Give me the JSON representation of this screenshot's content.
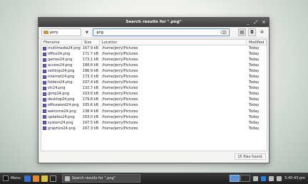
{
  "window": {
    "title": "Search results for \".png\"",
    "controls": {
      "minimize": "_",
      "maximize": "⤢",
      "close": "✕"
    }
  },
  "toolbar": {
    "location": "jerry",
    "dropdown_arrow": "▼",
    "search_value": ".png",
    "clear_icon": "⌫",
    "view_list_icon": "▤",
    "camera_icon": "◘",
    "settings_icon": "✲"
  },
  "columns": [
    "Filename",
    "Size",
    "Location",
    "Modified"
  ],
  "files": [
    {
      "name": "multimedia24.png",
      "size": "167.9 kB",
      "location": "/home/jerry/Pictures",
      "modified": "Today"
    },
    {
      "name": "office24.png",
      "size": "171.7 kB",
      "location": "/home/jerry/Pictures",
      "modified": "Today"
    },
    {
      "name": "games24.png",
      "size": "173.1 kB",
      "location": "/home/jerry/Pictures",
      "modified": "Today"
    },
    {
      "name": "access24.png",
      "size": "188.8 kB",
      "location": "/home/jerry/Pictures",
      "modified": "Today"
    },
    {
      "name": "settings24.png",
      "size": "196.9 kB",
      "location": "/home/jerry/Pictures",
      "modified": "Today"
    },
    {
      "name": "internet24.png",
      "size": "173.3 kB",
      "location": "/home/jerry/Pictures",
      "modified": "Today"
    },
    {
      "name": "folders24.png",
      "size": "107.4 kB",
      "location": "/home/jerry/Pictures",
      "modified": "Today"
    },
    {
      "name": "vlc24.png",
      "size": "132.7 kB",
      "location": "/home/jerry/Pictures",
      "modified": "Today"
    },
    {
      "name": "gimp24.png",
      "size": "103.6 kB",
      "location": "/home/jerry/Pictures",
      "modified": "Today"
    },
    {
      "name": "desktop24.png",
      "size": "179.8 kB",
      "location": "/home/jerry/Pictures",
      "modified": "Today"
    },
    {
      "name": "officeword24.png",
      "size": "105.6 kB",
      "location": "/home/jerry/Pictures",
      "modified": "Today"
    },
    {
      "name": "welcome24.png",
      "size": "138.4 kB",
      "location": "/home/jerry/Pictures",
      "modified": "Today"
    },
    {
      "name": "updates24.png",
      "size": "163.0 kB",
      "location": "/home/jerry/Pictures",
      "modified": "Today"
    },
    {
      "name": "system24.png",
      "size": "197.5 kB",
      "location": "/home/jerry/Pictures",
      "modified": "Today"
    },
    {
      "name": "graphics24.png",
      "size": "167.3 kB",
      "location": "/home/jerry/Pictures",
      "modified": "Today"
    }
  ],
  "status": "15 files found.",
  "taskbar": {
    "menu_label": "Menu",
    "task_label": "Search results for \".png\"",
    "clock": "5:45:43 pm",
    "colors": {
      "accent": "#5b8fd1",
      "file_icon": "#6a5db0"
    }
  }
}
